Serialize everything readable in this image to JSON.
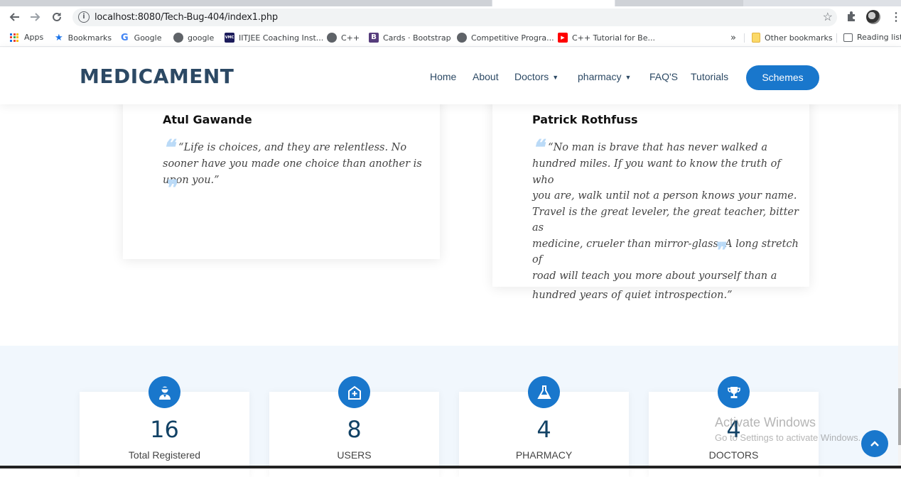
{
  "browser": {
    "url": "localhost:8080/Tech-Bug-404/index1.php",
    "bookmarks": [
      {
        "label": "Apps",
        "icon": "apps-grid-icon"
      },
      {
        "label": "Bookmarks",
        "icon": "star-icon"
      },
      {
        "label": "Google",
        "icon": "google-icon"
      },
      {
        "label": "google",
        "icon": "globe-icon"
      },
      {
        "label": "IITJEE Coaching Inst...",
        "icon": "vmc-icon"
      },
      {
        "label": "C++",
        "icon": "globe-icon"
      },
      {
        "label": "Cards · Bootstrap",
        "icon": "bootstrap-icon"
      },
      {
        "label": "Competitive Progra...",
        "icon": "globe-icon"
      },
      {
        "label": "C++ Tutorial for Be...",
        "icon": "youtube-icon"
      }
    ],
    "overflow_label": "»",
    "other_bookmarks": "Other bookmarks",
    "reading_list": "Reading list",
    "vmc_badge": "VMC",
    "bootstrap_badge": "B",
    "google_badge": "G"
  },
  "site": {
    "logo": "MEDICAMENT",
    "nav": [
      {
        "label": "Home",
        "dropdown": false
      },
      {
        "label": "About",
        "dropdown": false
      },
      {
        "label": "Doctors",
        "dropdown": true
      },
      {
        "label": "pharmacy",
        "dropdown": true
      },
      {
        "label": "FAQ'S",
        "dropdown": false
      },
      {
        "label": "Tutorials",
        "dropdown": false
      }
    ],
    "cta": "Schemes"
  },
  "testimonials": [
    {
      "name": "Atul Gawande",
      "quote": "“Life is choices, and they are relentless. No sooner have you made one choice than another is upon you.”"
    },
    {
      "name": "Patrick Rothfuss",
      "quote_lines": [
        "“No man is brave that has never walked a",
        "hundred miles. If you want to know the truth of who",
        "you are, walk until not a person knows your name.",
        "Travel is the great leveler, the great teacher, bitter as",
        "medicine, crueler than mirror-glass. A long stretch of",
        "road will teach you more about yourself than a",
        "hundred years of quiet introspection.”"
      ]
    }
  ],
  "counts": [
    {
      "value": "16",
      "label": "Total Registered",
      "icon": "doctor-icon"
    },
    {
      "value": "8",
      "label": "USERS",
      "icon": "hospital-icon"
    },
    {
      "value": "4",
      "label": "PHARMACY",
      "icon": "flask-icon"
    },
    {
      "value": "4",
      "label": "DOCTORS",
      "icon": "trophy-icon"
    }
  ],
  "watermark": {
    "title": "Activate Windows",
    "subtitle": "Go to Settings to activate Windows."
  },
  "colors": {
    "brand": "#2c4964",
    "accent": "#1977cc",
    "section_bg": "#f1f7fd",
    "quote_mark": "#badaf7"
  }
}
